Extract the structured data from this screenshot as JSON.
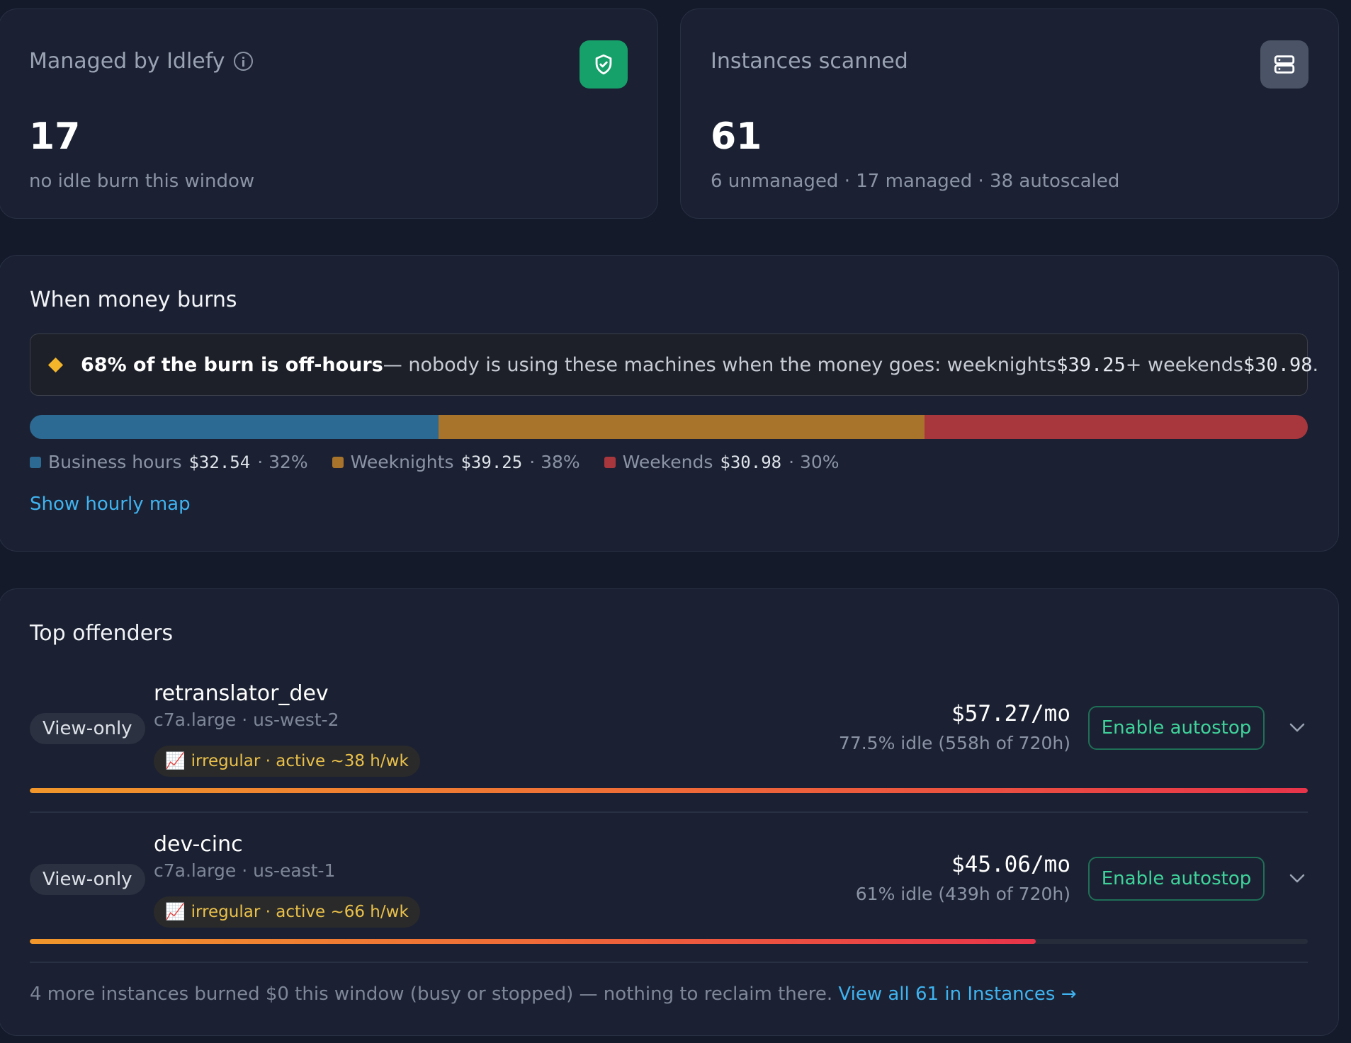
{
  "managed": {
    "label": "Managed by Idlefy",
    "value": "17",
    "subtitle": "no idle burn this window",
    "icon": "shield-check-icon",
    "icon_color": "#16a06a"
  },
  "scanned": {
    "label": "Instances scanned",
    "value": "61",
    "subtitle": "6 unmanaged · 17 managed · 38 autoscaled",
    "icon": "server-icon"
  },
  "burn": {
    "title": "When money burns",
    "callout": {
      "bold": "68% of the burn is off-hours",
      "text": " — nobody is using these machines when the money goes: weeknights ",
      "weeknights": "$39.25",
      "plus": " + weekends ",
      "weekends": "$30.98",
      "end": "."
    },
    "segments": [
      {
        "name": "Business hours",
        "amount": "$32.54",
        "pct_label": "· 32%",
        "pct": 32,
        "color": "#2d6a93"
      },
      {
        "name": "Weeknights",
        "amount": "$39.25",
        "pct_label": "· 38%",
        "pct": 38,
        "color": "#a8732a"
      },
      {
        "name": "Weekends",
        "amount": "$30.98",
        "pct_label": "· 30%",
        "pct": 30,
        "color": "#a8363d"
      }
    ],
    "hourly_link": "Show hourly map"
  },
  "offenders": {
    "title": "Top offenders",
    "rows": [
      {
        "badge": "View-only",
        "name": "retranslator_dev",
        "meta": "c7a.large · us-west-2",
        "tag_icon": "📈",
        "tag": "irregular · active ~38 h/wk",
        "price": "$57.27/mo",
        "idle": "77.5% idle (558h of 720h)",
        "button": "Enable autostop",
        "level": 1.0
      },
      {
        "badge": "View-only",
        "name": "dev-cinc",
        "meta": "c7a.large · us-east-1",
        "tag_icon": "📈",
        "tag": "irregular · active ~66 h/wk",
        "price": "$45.06/mo",
        "idle": "61% idle (439h of 720h)",
        "button": "Enable autostop",
        "level": 0.787
      }
    ],
    "footer_text": "4 more instances burned $0 this window (busy or stopped) — nothing to reclaim there. ",
    "footer_link": "View all 61 in Instances →"
  }
}
